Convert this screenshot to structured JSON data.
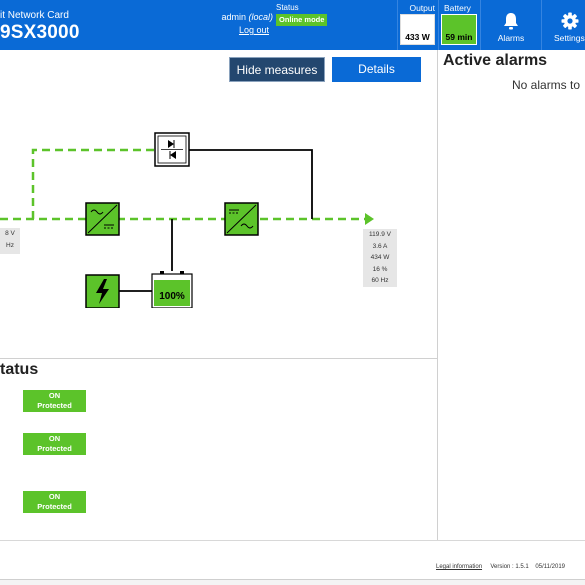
{
  "header": {
    "card_name": "it Network Card",
    "model": "9SX3000",
    "user_name": "admin",
    "user_scope": "(local)",
    "logout": "Log out",
    "status_label": "Status",
    "status_value": "Online mode",
    "output_label": "Output",
    "output_value": "433 W",
    "battery_label": "Battery",
    "battery_value": "59 min",
    "alarms_label": "Alarms",
    "settings_label": "Settings"
  },
  "toolbar": {
    "hide_measures": "Hide measures",
    "details": "Details"
  },
  "diagram": {
    "battery_level": "100%",
    "input_readings": [
      "8 V",
      "Hz"
    ],
    "output_readings": [
      "119.9 V",
      "3.6 A",
      "434 W",
      "16 %",
      "60 Hz"
    ],
    "colors": {
      "flow": "#5cc32a",
      "box": "#5cc32a",
      "line": "#000000"
    }
  },
  "outlets": {
    "title": "tatus",
    "items": [
      {
        "state": "ON",
        "detail": "Protected"
      },
      {
        "state": "ON",
        "detail": "Protected"
      },
      {
        "state": "ON",
        "detail": "Protected"
      }
    ]
  },
  "alarms": {
    "title": "Active alarms",
    "empty_text": "No alarms to"
  },
  "footer": {
    "legal": "Legal information",
    "version": "Version : 1.5.1",
    "date": "05/11/2019"
  }
}
